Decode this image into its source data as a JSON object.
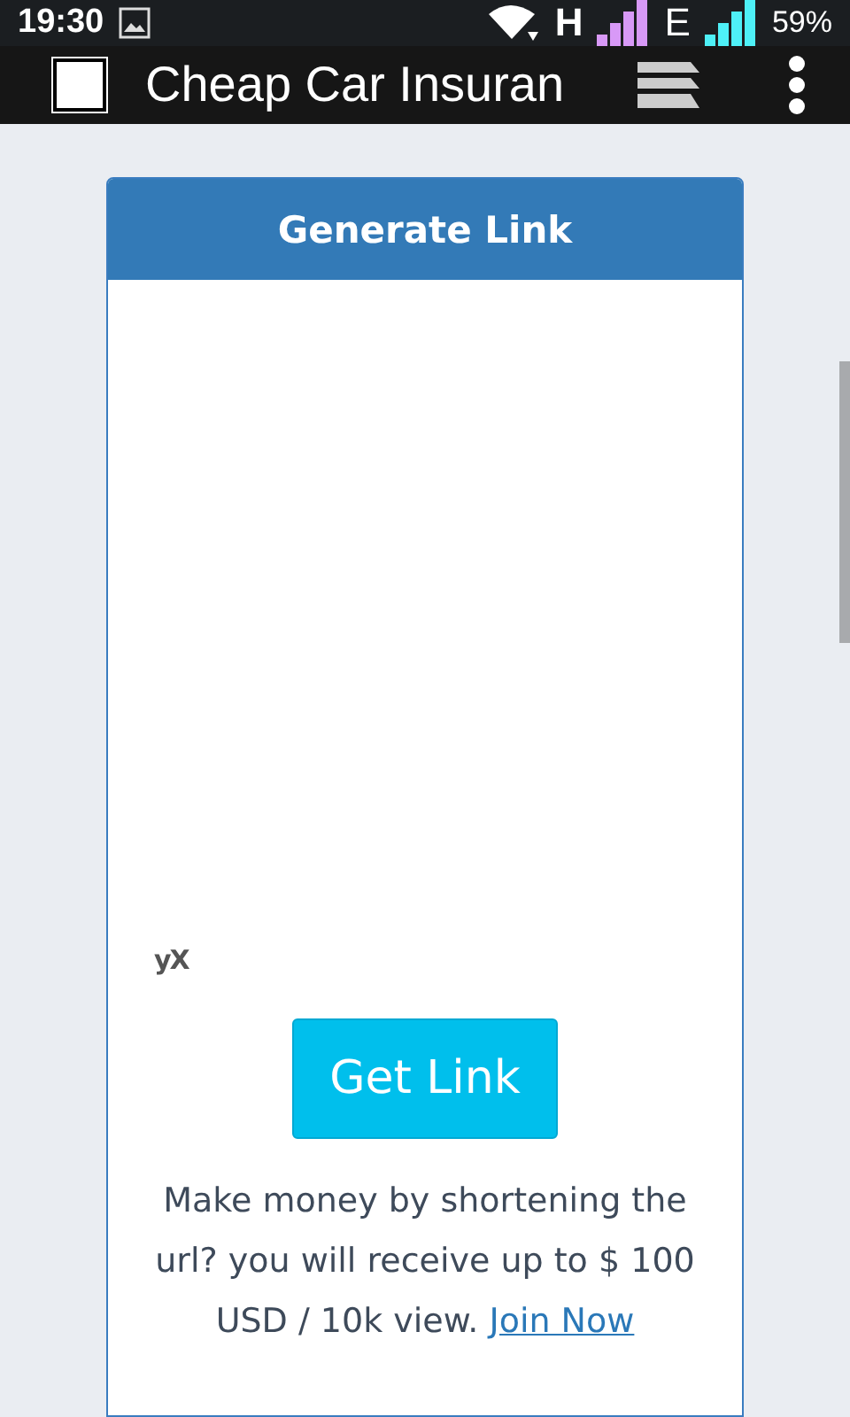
{
  "status_bar": {
    "time": "19:30",
    "network_1": "H",
    "network_2": "E",
    "battery": "59%"
  },
  "app_bar": {
    "title": "Cheap Car Insuran"
  },
  "card": {
    "title": "Generate Link",
    "ad_logo": "yX",
    "button": "Get Link",
    "message": "Make money by shortening the url? you will receive up to $ 100 USD / 10k view.",
    "link": "Join Now"
  }
}
